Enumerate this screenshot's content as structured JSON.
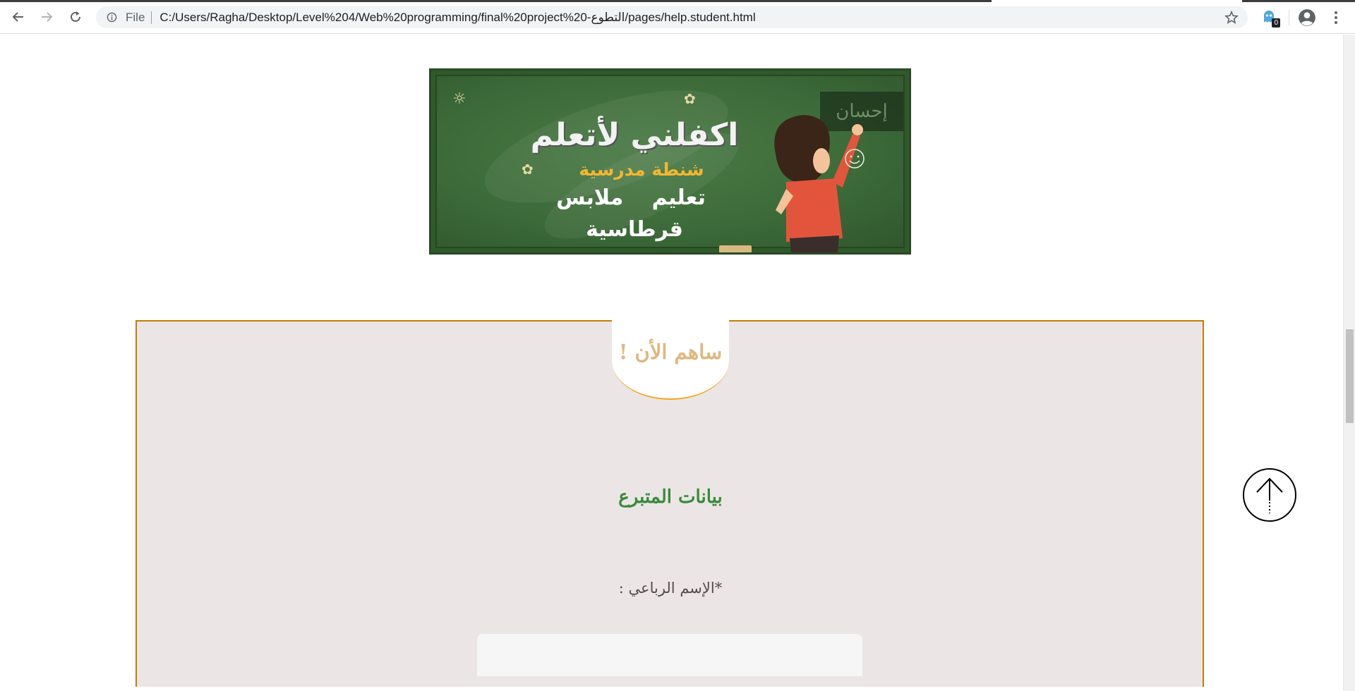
{
  "browser": {
    "scheme_label": "File",
    "url": "C:/Users/Ragha/Desktop/Level%204/Web%20programming/final%20project%20-التطوع/pages/help.student.html",
    "extension_badge": "0"
  },
  "banner": {
    "brand": "إحسان",
    "headline": "اكفلني لأتعلم",
    "subline": "شنطة مدرسية",
    "line3": "تعليم ملابس",
    "line4": "قرطاسية"
  },
  "form": {
    "legend": "ساهم الأن !",
    "section_heading": "بيانات المتبرع",
    "full_name_label": "*الإسم الرباعي :",
    "full_name_value": ""
  },
  "colors": {
    "accent_border": "#c77d00",
    "legend_text": "#dfb880",
    "heading_green": "#3a8a3a",
    "form_background": "#ebe6e5"
  }
}
